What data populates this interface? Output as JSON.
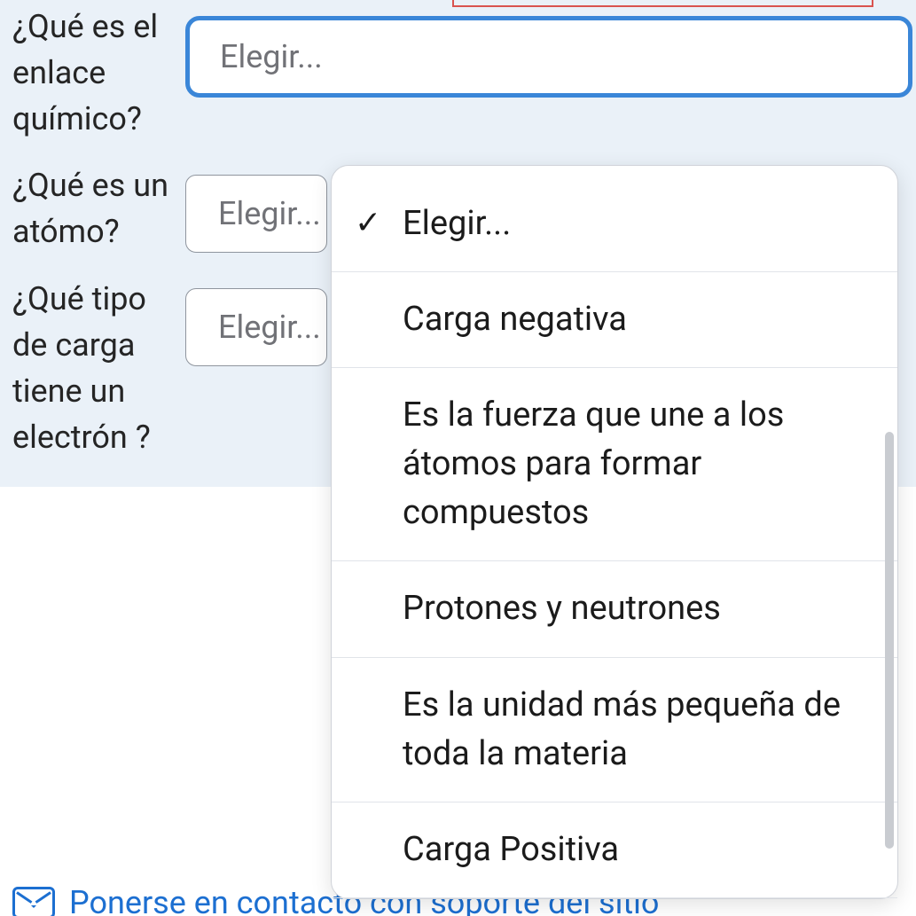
{
  "questions": [
    {
      "label": "¿Qué es el enlace químico?",
      "selected": "Elegir..."
    },
    {
      "label": "¿Qué es un atómo?",
      "selected": "Elegir..."
    },
    {
      "label": "¿Qué tipo de carga tiene un electrón ?",
      "selected": "Elegir..."
    }
  ],
  "dropdown": {
    "placeholder": "Elegir...",
    "options": [
      "Carga negativa",
      "Es la fuerza que une a los átomos para formar compuestos",
      "Protones y neutrones",
      "Es la unidad más pequeña de toda la materia",
      "Carga Positiva"
    ]
  },
  "footer": {
    "contact_text": "Ponerse en contacto con soporte del sitio"
  }
}
